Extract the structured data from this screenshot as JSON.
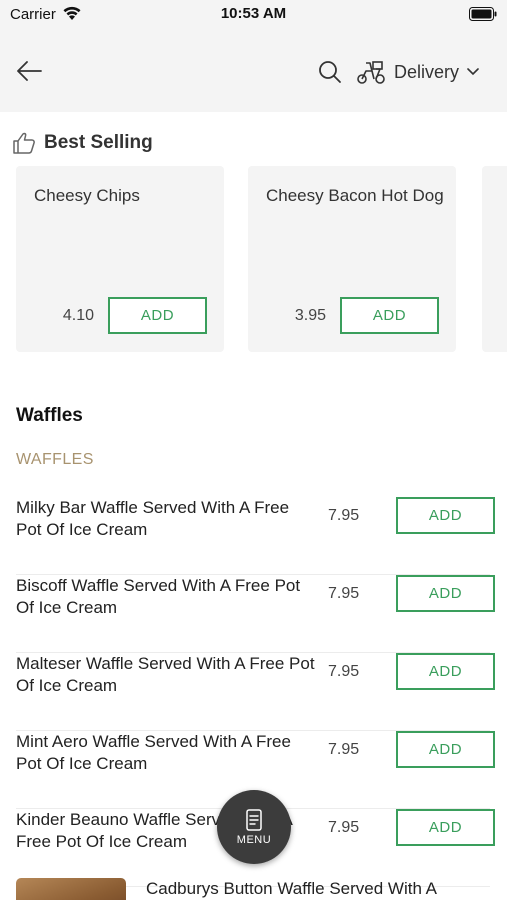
{
  "status": {
    "carrier": "Carrier",
    "time": "10:53 AM"
  },
  "header": {
    "delivery_label": "Delivery"
  },
  "best_selling": {
    "title": "Best Selling",
    "items": [
      {
        "name": "Cheesy Chips",
        "price": "4.10",
        "add_label": "ADD"
      },
      {
        "name": "Cheesy Bacon Hot Dog",
        "price": "3.95",
        "add_label": "ADD"
      }
    ]
  },
  "category": {
    "title": "Waffles",
    "subtitle": "WAFFLES",
    "items": [
      {
        "name": "Milky Bar Waffle Served With A Free Pot Of Ice Cream",
        "price": "7.95",
        "add_label": "ADD"
      },
      {
        "name": "Biscoff Waffle Served With A Free Pot Of Ice Cream",
        "price": "7.95",
        "add_label": "ADD"
      },
      {
        "name": "Malteser Waffle Served With A Free Pot Of Ice Cream",
        "price": "7.95",
        "add_label": "ADD"
      },
      {
        "name": "Mint Aero Waffle Served With A Free Pot Of Ice Cream",
        "price": "7.95",
        "add_label": "ADD"
      },
      {
        "name": "Kinder Beauno Waffle Served With A Free Pot Of Ice Cream",
        "price": "7.95",
        "add_label": "ADD"
      }
    ],
    "partial_item": {
      "name": "Cadburys Button Waffle Served With A"
    }
  },
  "fab": {
    "label": "MENU"
  },
  "colors": {
    "accent_green": "#3a9e5c",
    "subtitle_gold": "#a8936f",
    "fab_bg": "#3c3c3c"
  }
}
